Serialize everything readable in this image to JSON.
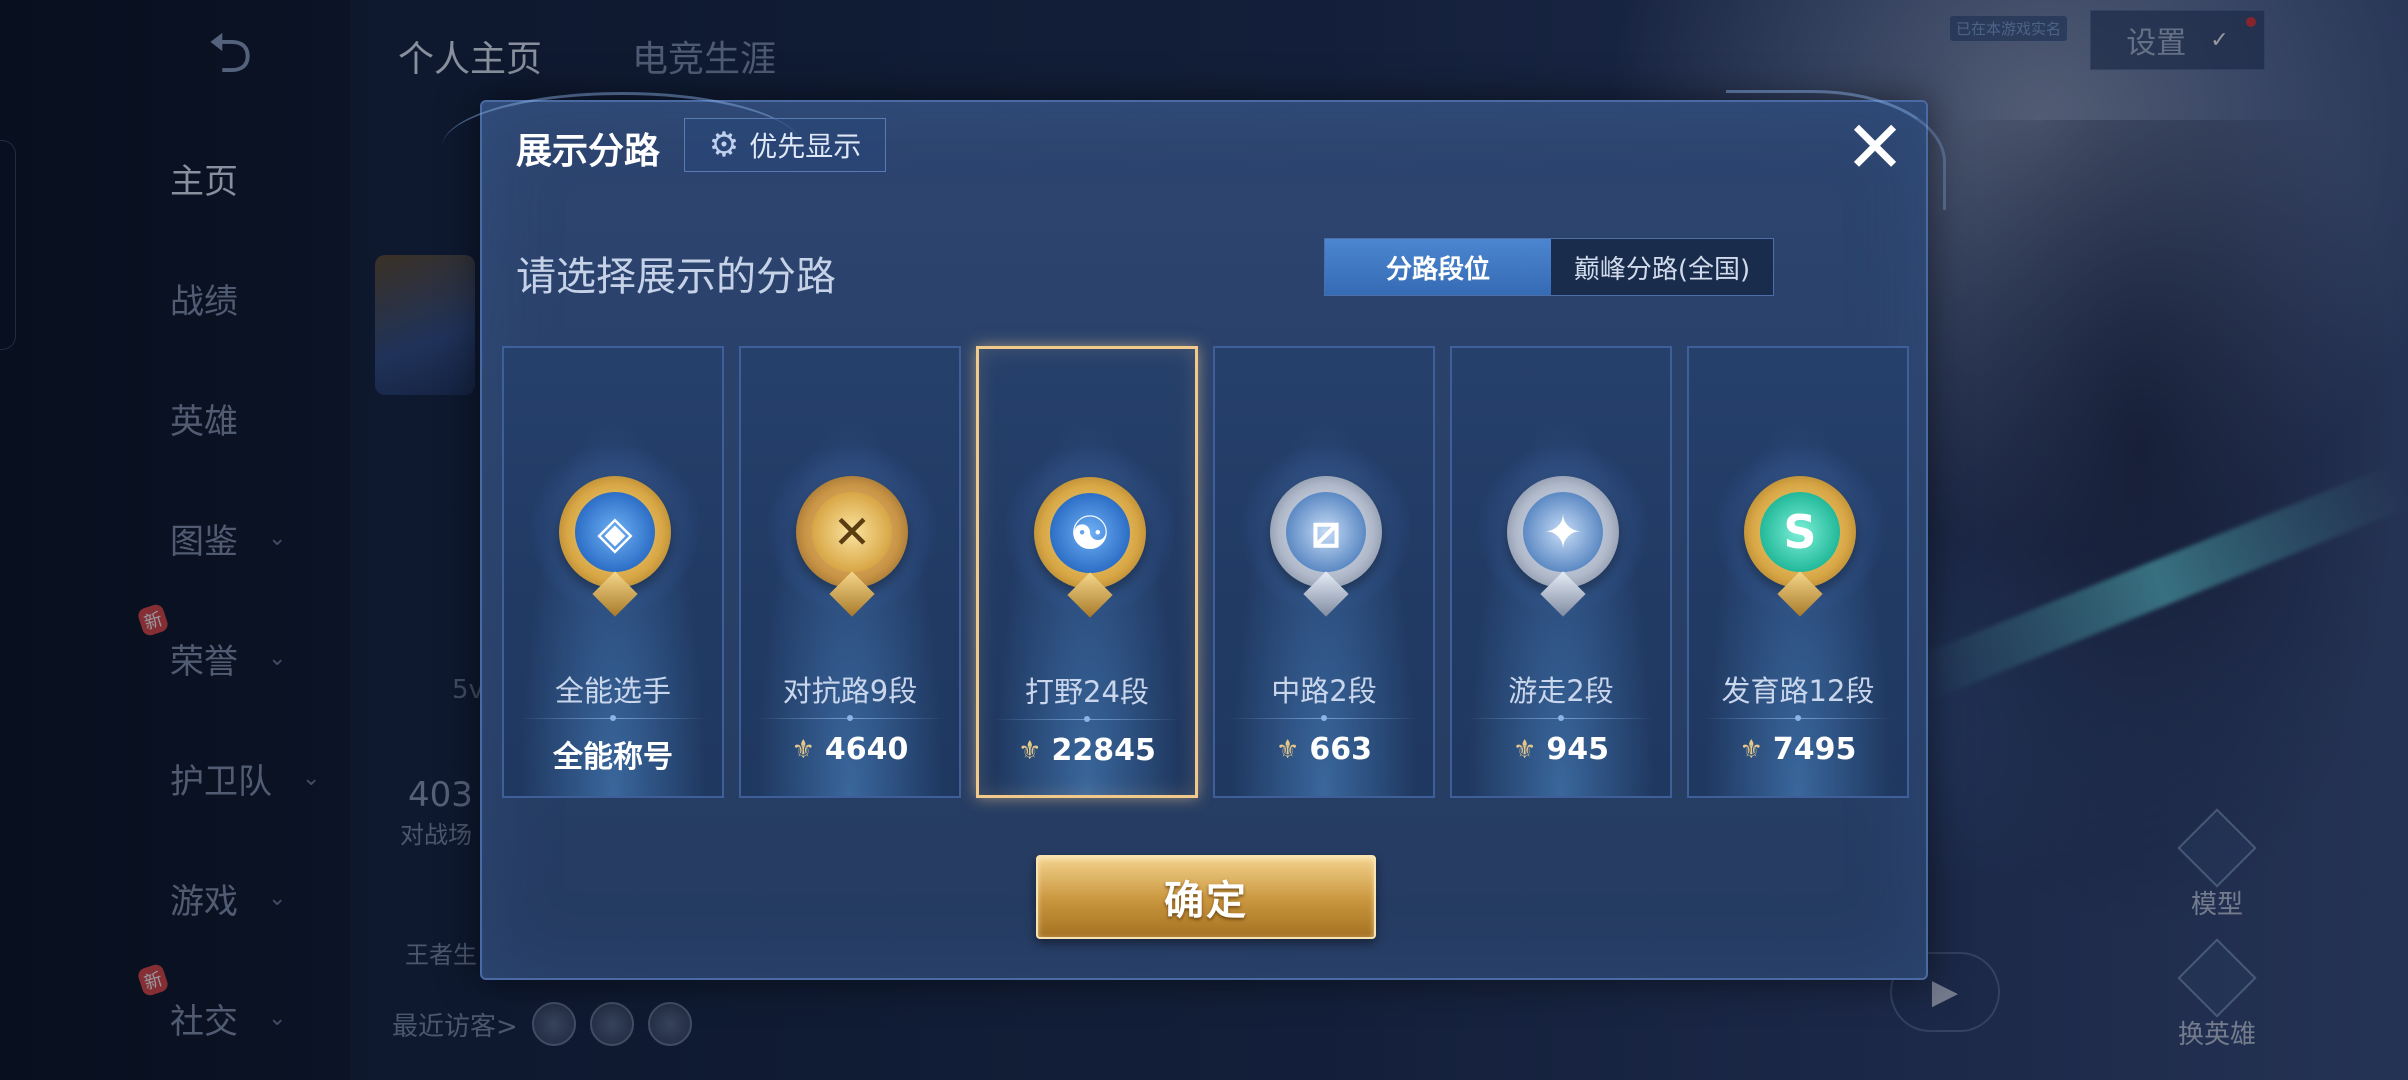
{
  "background": {
    "top_hint": "已在本游戏实名",
    "settings_label": "设置",
    "tabs": [
      "个人主页",
      "电竞生涯"
    ],
    "nav": [
      {
        "label": "主页",
        "active": true,
        "has_chevron": false,
        "is_new": false
      },
      {
        "label": "战绩",
        "active": false,
        "has_chevron": false,
        "is_new": false
      },
      {
        "label": "英雄",
        "active": false,
        "has_chevron": false,
        "is_new": false
      },
      {
        "label": "图鉴",
        "active": false,
        "has_chevron": true,
        "is_new": false
      },
      {
        "label": "荣誉",
        "active": false,
        "has_chevron": true,
        "is_new": true
      },
      {
        "label": "护卫队",
        "active": false,
        "has_chevron": true,
        "is_new": false
      },
      {
        "label": "游戏",
        "active": false,
        "has_chevron": true,
        "is_new": false
      },
      {
        "label": "社交",
        "active": false,
        "has_chevron": true,
        "is_new": true
      }
    ],
    "new_badge": "新",
    "peek_number": "403",
    "peek_text": "对战场",
    "peek_small": "5v",
    "peek_king": "王者生",
    "recent_visitors_label": "最近访客>",
    "right_actions": [
      "模型",
      "换英雄"
    ]
  },
  "modal": {
    "title": "展示分路",
    "priority_label": "优先显示",
    "close_symbol": "✕",
    "subtitle": "请选择展示的分路",
    "segments": [
      {
        "label": "分路段位",
        "active": true
      },
      {
        "label": "巅峰分路(全国)",
        "active": false
      }
    ],
    "cards": [
      {
        "name": "全能选手",
        "value": "全能称号",
        "show_icon": false,
        "selected": false,
        "badge": "all-round-badge",
        "glyph": "◈"
      },
      {
        "name": "对抗路9段",
        "value": "4640",
        "show_icon": true,
        "selected": false,
        "badge": "clash-lane-badge",
        "glyph": "✕"
      },
      {
        "name": "打野24段",
        "value": "22845",
        "show_icon": true,
        "selected": true,
        "badge": "jungle-badge",
        "glyph": "☯"
      },
      {
        "name": "中路2段",
        "value": "663",
        "show_icon": true,
        "selected": false,
        "badge": "mid-lane-badge",
        "glyph": "⧄"
      },
      {
        "name": "游走2段",
        "value": "945",
        "show_icon": true,
        "selected": false,
        "badge": "roam-badge",
        "glyph": "✦"
      },
      {
        "name": "发育路12段",
        "value": "7495",
        "show_icon": true,
        "selected": false,
        "badge": "farm-lane-badge",
        "glyph": "S"
      }
    ],
    "confirm_label": "确定"
  },
  "colors": {
    "modal_bg": "#294068",
    "selected_border": "#f1c98a",
    "segment_active": "#4c86d0",
    "confirm_gold": "#c9953d"
  }
}
